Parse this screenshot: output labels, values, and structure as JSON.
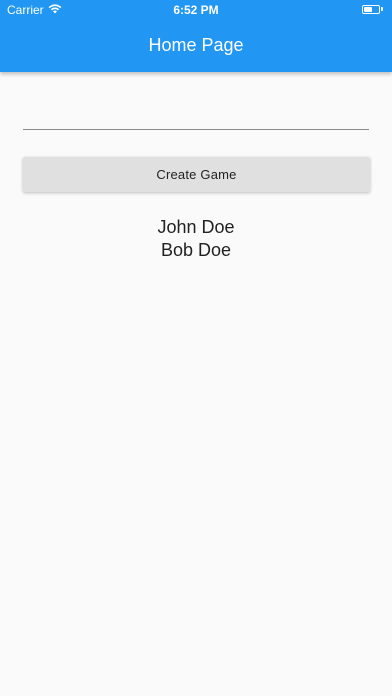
{
  "status_bar": {
    "carrier": "Carrier",
    "time": "6:52 PM",
    "wifi_icon": "wifi-icon",
    "battery_icon": "battery-icon"
  },
  "app_bar": {
    "title": "Home Page",
    "color": "#2196f3"
  },
  "form": {
    "input_value": "",
    "input_placeholder": "",
    "create_button_label": "Create Game"
  },
  "players": [
    "John Doe",
    "Bob Doe"
  ]
}
